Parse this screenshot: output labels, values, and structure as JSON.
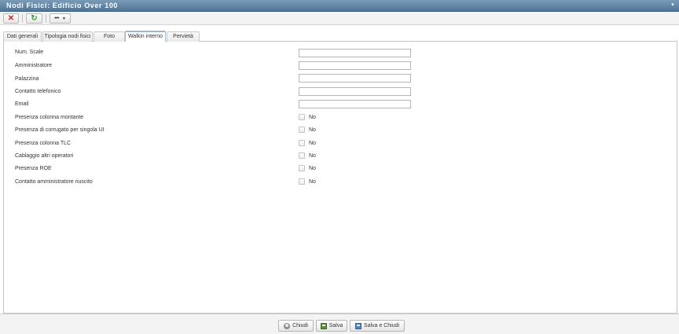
{
  "window": {
    "title": "Nodi Fisici: Edificio Over 100",
    "collapse_glyph": "▾"
  },
  "toolbar": {
    "delete_icon": "close-x-icon",
    "refresh_icon": "refresh-icon",
    "more_icon": "more-dots-icon",
    "delete_glyph": "✕",
    "refresh_glyph": "↻",
    "more_glyph": "•••",
    "caret_glyph": "▼"
  },
  "tabs": [
    {
      "label": "Dati generali",
      "active": false
    },
    {
      "label": "Tipologia nodi fisici",
      "active": false
    },
    {
      "label": "Foto",
      "active": false
    },
    {
      "label": "Walkin interno",
      "active": true
    },
    {
      "label": "Pervietà",
      "active": false
    }
  ],
  "form": {
    "text_fields": [
      {
        "label": "Num. Scale",
        "value": ""
      },
      {
        "label": "Amministratore",
        "value": ""
      },
      {
        "label": "Palazzina",
        "value": ""
      },
      {
        "label": "Contatto telefonico",
        "value": ""
      },
      {
        "label": "Email",
        "value": ""
      }
    ],
    "checkbox_fields": [
      {
        "label": "Presenza colonna montante",
        "checked": false,
        "state_text": "No"
      },
      {
        "label": "Presenza di corrugato per singola UI",
        "checked": false,
        "state_text": "No"
      },
      {
        "label": "Presenza colonna TLC",
        "checked": false,
        "state_text": "No"
      },
      {
        "label": "Cablaggio altri operatori",
        "checked": false,
        "state_text": "No"
      },
      {
        "label": "Presenza ROE",
        "checked": false,
        "state_text": "No"
      },
      {
        "label": "Contatto amministratore riuscito",
        "checked": false,
        "state_text": "No"
      }
    ]
  },
  "footer": {
    "close_label": "Chiudi",
    "save_label": "Salva",
    "save_close_label": "Salva e Chiudi",
    "close_glyph": "⊗"
  },
  "colors": {
    "title_bar": "#5b80a3",
    "active_tab_accent": "#6a9cc9",
    "delete_icon": "#d21e1e",
    "refresh_icon": "#2e9e3a"
  }
}
